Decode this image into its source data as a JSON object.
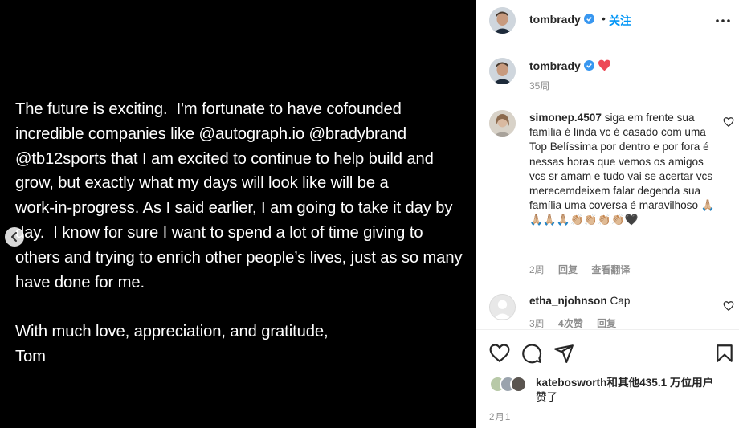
{
  "media": {
    "paragraph1": "The future is exciting.  I'm fortunate to have cofounded\nincredible companies like @autograph.io @bradybrand\n@tb12sports that I am excited to continue to help build and\ngrow, but exactly what my days will look like will be a\nwork-in-progress. As I said earlier, I am going to take it day by\nday.  I know for sure I want to spend a lot of time giving to\nothers and trying to enrich other people’s lives, just as so many\nhave done for me.",
    "paragraph2": "With much love, appreciation, and gratitude,\nTom"
  },
  "header": {
    "username": "tombrady",
    "dot": "•",
    "follow_label": "关注"
  },
  "caption": {
    "username": "tombrady",
    "time": "35周"
  },
  "comments": [
    {
      "username": "simonep.4507",
      "text": "siga em frente sua família é linda vc é casado com uma Top Belíssima por dentro e por fora é nessas horas que vemos os amigos vcs sr amam e tudo vai se acertar vcs merecemdeixem falar degenda sua família uma coversa é maravilhoso 🙏🏼🙏🏼🙏🏼🙏🏼👏🏼👏🏼👏🏼👏🏼🖤",
      "time": "2周",
      "reply_label": "回复",
      "translate_label": "查看翻译"
    },
    {
      "username": "etha_njohnson",
      "text": "Cap",
      "time": "3周",
      "likes": "4次赞",
      "reply_label": "回复"
    }
  ],
  "likes": {
    "user": "katebosworth",
    "rest": "和其他435.1 万位用户",
    "suffix": "赞了"
  },
  "post_date": "2月1",
  "colors": {
    "accent": "#0095f6",
    "verified": "#3897f0",
    "heart": "#ed4956",
    "muted": "#8e8e8e"
  }
}
